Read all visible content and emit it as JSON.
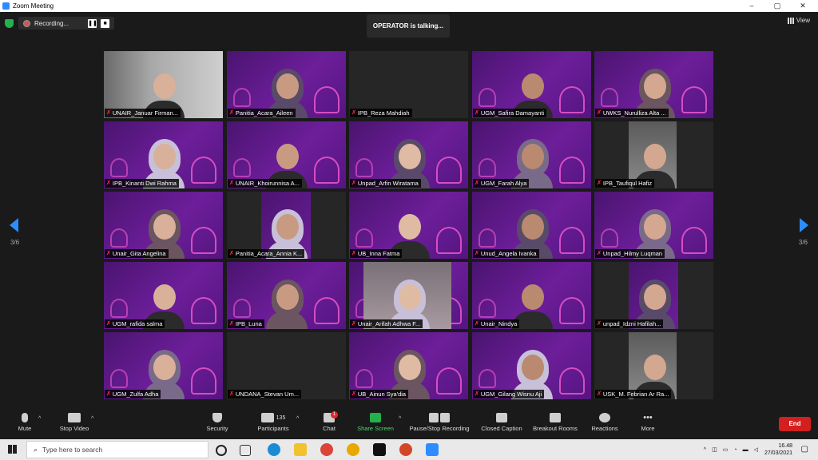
{
  "window": {
    "title": "Zoom Meeting",
    "minimize": "–",
    "maximize": "▢",
    "close": "✕"
  },
  "meeting": {
    "recording_label": "Recording...",
    "pause_icon": "❚❚",
    "stop_icon": "■",
    "talking_banner": "OPERATOR is talking...",
    "view_label": "View",
    "page_left": "3/6",
    "page_right": "3/6"
  },
  "participants": [
    {
      "name": "UNAIR_Januar Firman...",
      "bg": "photo"
    },
    {
      "name": "Panitia_Acara_Aileen",
      "bg": "purple"
    },
    {
      "name": "IPB_Reza Mahdiah",
      "bg": "dark"
    },
    {
      "name": "UGM_Safira Damayanti",
      "bg": "purple"
    },
    {
      "name": "UWKS_Nurulliza Alta ...",
      "bg": "purple"
    },
    {
      "name": "IPB_Kinanti Dwi Rahma",
      "bg": "purple"
    },
    {
      "name": "UNAIR_Khoirunnisa A...",
      "bg": "purple"
    },
    {
      "name": "Unpad_Arfin Wiratama",
      "bg": "purple"
    },
    {
      "name": "UGM_Farah Alya",
      "bg": "purple"
    },
    {
      "name": "IPB_Taufiqul Hafiz",
      "bg": "photo-small"
    },
    {
      "name": "Unair_Gita Angelina",
      "bg": "purple"
    },
    {
      "name": "Panitia_Acara_Annia K...",
      "bg": "dark-banner"
    },
    {
      "name": "UB_Inna Fatma",
      "bg": "purple"
    },
    {
      "name": "Unud_Angela Ivanka",
      "bg": "purple"
    },
    {
      "name": "Unpad_Hilmy Luqman",
      "bg": "purple"
    },
    {
      "name": "UGM_rafida salma",
      "bg": "purple"
    },
    {
      "name": "IPB_Luna",
      "bg": "purple"
    },
    {
      "name": "Unair_Arifah Adhwa F...",
      "bg": "mixed"
    },
    {
      "name": "Unair_Nindya",
      "bg": "purple"
    },
    {
      "name": "unpad_Idzni Hafilah...",
      "bg": "dark-banner"
    },
    {
      "name": "UGM_Zulfa Adha",
      "bg": "purple"
    },
    {
      "name": "UNDANA_Stevan Um...",
      "bg": "dark"
    },
    {
      "name": "UB_Ainun Sya'dia",
      "bg": "purple"
    },
    {
      "name": "UGM_Gilang Wisnu Aji",
      "bg": "purple"
    },
    {
      "name": "USK_M. Febrian Ar Ra...",
      "bg": "photo-small"
    }
  ],
  "toolbar": {
    "mute": "Mute",
    "stop_video": "Stop Video",
    "security": "Security",
    "participants": "Participants",
    "participants_count": "135",
    "chat": "Chat",
    "chat_badge": "1",
    "share_screen": "Share Screen",
    "pause_stop_recording": "Pause/Stop Recording",
    "closed_caption": "Closed Caption",
    "breakout_rooms": "Breakout Rooms",
    "reactions": "Reactions",
    "more": "More",
    "end": "End"
  },
  "taskbar": {
    "search_placeholder": "Type here to search",
    "time": "16.48",
    "date": "27/03/2021"
  },
  "colors": {
    "accent": "#2d8cff",
    "end_button": "#d1201f",
    "share_green": "#23b14d",
    "tile_purple": "#6d1e9a"
  }
}
